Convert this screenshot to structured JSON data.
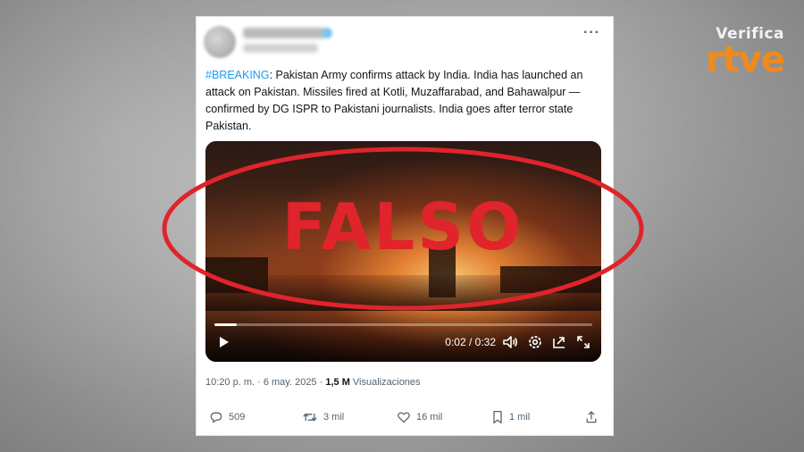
{
  "brand": {
    "verifica": "Verifica",
    "logo": "rtve",
    "accent": "#f08a1c"
  },
  "tweet": {
    "hashtag": "#BREAKING",
    "body": ": Pakistan Army confirms attack by India. India has launched an attack on Pakistan. Missiles fired at Kotli, Muzaffarabad, and Bahawalpur — confirmed by DG ISPR to Pakistani journalists. India goes after terror state Pakistan.",
    "more_icon": "more-icon"
  },
  "video": {
    "current_time": "0:02",
    "separator": " / ",
    "duration": "0:32",
    "progress": 0.06,
    "controls": [
      "play-icon",
      "volume-icon",
      "settings-icon",
      "pip-icon",
      "fullscreen-icon"
    ]
  },
  "stamp": {
    "text": "FALSO",
    "color": "#e0242b"
  },
  "meta": {
    "time": "10:20 p. m.",
    "dot": " · ",
    "date": "6 may. 2025",
    "views_count": "1,5 M",
    "views_label": "Visualizaciones"
  },
  "actions": {
    "replies": "509",
    "reposts": "3 mil",
    "likes": "16 mil",
    "bookmarks": "1 mil"
  },
  "colors": {
    "link": "#1d9bf0",
    "muted": "#536471",
    "text": "#0f1419"
  }
}
